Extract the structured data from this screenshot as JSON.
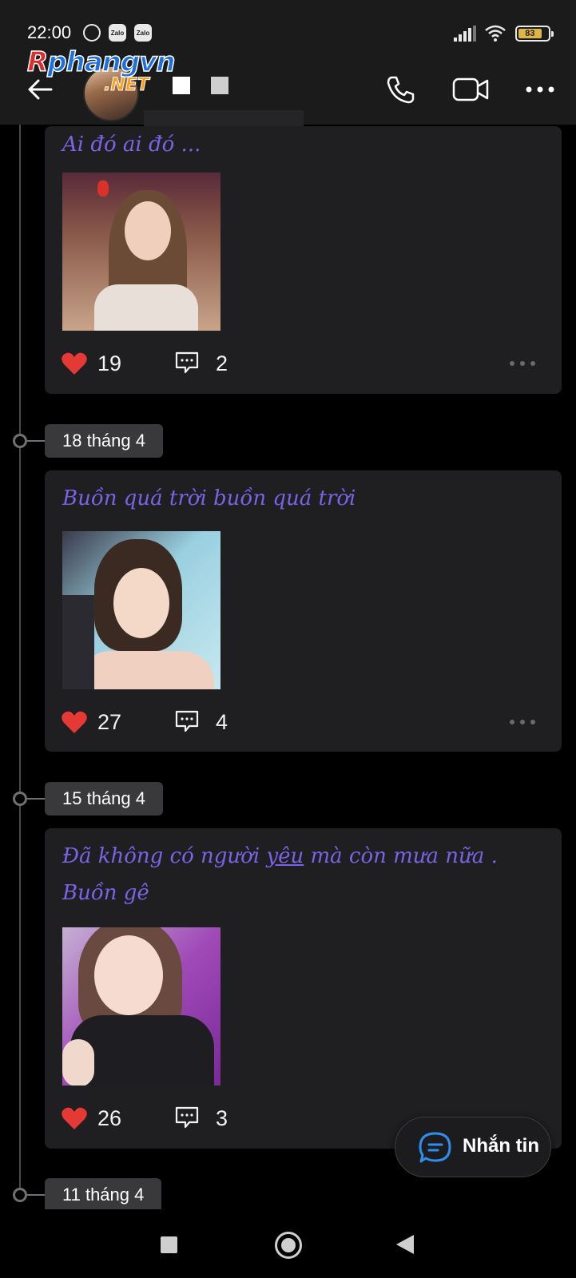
{
  "status_bar": {
    "time": "22:00",
    "app_icons": [
      "Zalo",
      "Zalo"
    ],
    "battery": "83"
  },
  "header": {
    "watermark": {
      "brand": "phangvn",
      "brand_initial": "R",
      "domain": ".NET"
    }
  },
  "timeline": {
    "dates": [
      "18 tháng 4",
      "15 tháng 4",
      "11 tháng 4"
    ]
  },
  "posts": [
    {
      "text": "Ai đó ai đó ...",
      "likes": "19",
      "comments": "2"
    },
    {
      "text": "Buồn quá trời buồn quá trời",
      "likes": "27",
      "comments": "4"
    },
    {
      "text_line1_a": "Đã không có người ",
      "text_line1_link": "yêu",
      "text_line1_b": " mà còn mưa nữa .",
      "text_line2": "Buồn gê",
      "likes": "26",
      "comments": "3"
    }
  ],
  "floating_button": {
    "label": "Nhắn tin"
  },
  "colors": {
    "post_text": "#7b62e6",
    "like": "#e53935",
    "card_bg": "#1f1f21",
    "chip_bg": "#39393b"
  }
}
